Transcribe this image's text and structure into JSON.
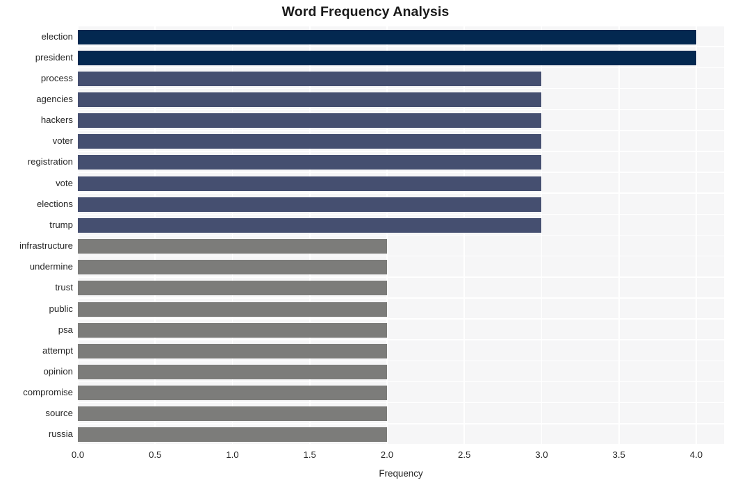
{
  "chart_data": {
    "type": "bar",
    "orientation": "horizontal",
    "title": "Word Frequency Analysis",
    "xlabel": "Frequency",
    "ylabel": "",
    "xlim": [
      0.0,
      4.18
    ],
    "xticks": [
      "0.0",
      "0.5",
      "1.0",
      "1.5",
      "2.0",
      "2.5",
      "3.0",
      "3.5",
      "4.0"
    ],
    "xtick_values": [
      0.0,
      0.5,
      1.0,
      1.5,
      2.0,
      2.5,
      3.0,
      3.5,
      4.0
    ],
    "grid": true,
    "legend": "none",
    "categories": [
      "election",
      "president",
      "process",
      "agencies",
      "hackers",
      "voter",
      "registration",
      "vote",
      "elections",
      "trump",
      "infrastructure",
      "undermine",
      "trust",
      "public",
      "psa",
      "attempt",
      "opinion",
      "compromise",
      "source",
      "russia"
    ],
    "values": [
      4,
      4,
      3,
      3,
      3,
      3,
      3,
      3,
      3,
      3,
      2,
      2,
      2,
      2,
      2,
      2,
      2,
      2,
      2,
      2
    ],
    "bar_colors": [
      "#032850",
      "#032850",
      "#454f70",
      "#454f70",
      "#454f70",
      "#454f70",
      "#454f70",
      "#454f70",
      "#454f70",
      "#454f70",
      "#7c7c7a",
      "#7c7c7a",
      "#7c7c7a",
      "#7c7c7a",
      "#7c7c7a",
      "#7c7c7a",
      "#7c7c7a",
      "#7c7c7a",
      "#7c7c7a",
      "#7c7c7a"
    ]
  },
  "style": {
    "figure_background": "#ffffff",
    "axes_background": "#f6f6f7",
    "grid_color": "#ffffff",
    "text_color": "#262626",
    "title_color": "#1a1a1a",
    "color_high": "#032850",
    "color_mid": "#454f70",
    "color_low": "#7c7c7a"
  }
}
